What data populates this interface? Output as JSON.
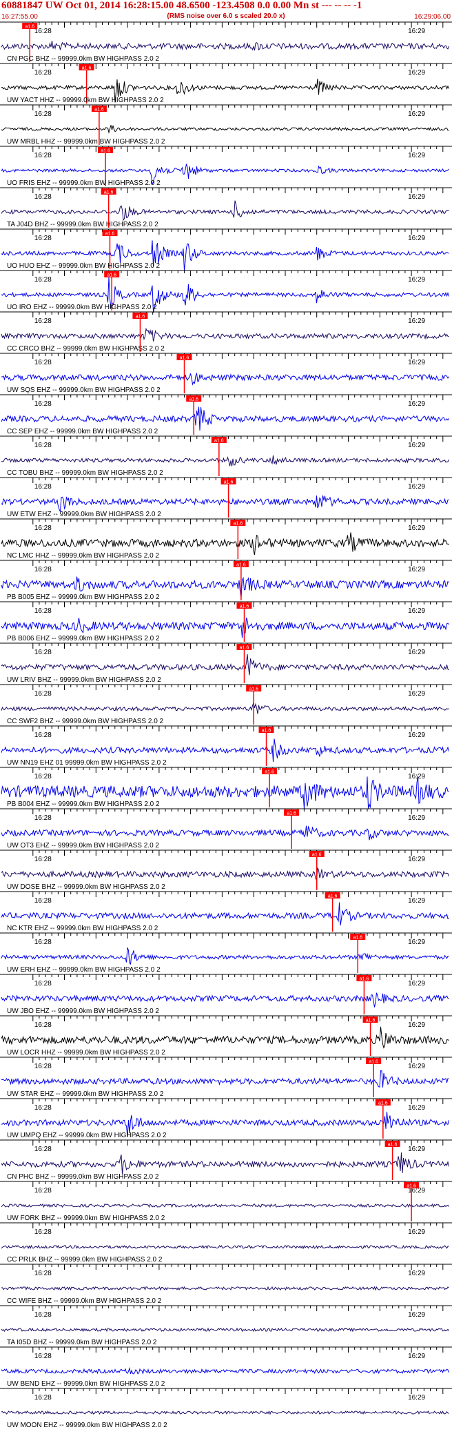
{
  "header": {
    "title": "60881847 UW Oct 01, 2014 16:28:15.00   48.6500 -123.4508  0.0 0.00 Mn st --- -- --   -1",
    "subtitle": "(RMS noise over 6.0 s scaled 20.0 x)",
    "start_time": "16:27:55.00",
    "end_time": "16:29:06.00"
  },
  "chart_data": {
    "type": "line",
    "title": "60881847 UW Oct 01, 2014 16:28:15.00   48.6500 -123.4508  0.0 0.00 Mn st --- -- --   -1",
    "subtitle": "(RMS noise over 6.0 s scaled 20.0 x)",
    "x_start": "16:27:55.00",
    "x_end": "16:29:06.00",
    "xlim_seconds": [
      0,
      71
    ],
    "tick_labels": [
      "16:28",
      "16:29"
    ],
    "pick_label": "a1.6",
    "grid": false,
    "colors": {
      "title": "#cc0000",
      "pick": "#ff0000",
      "black": "#000000",
      "blue": "#0000ee",
      "navy": "#1a0a66"
    },
    "series": [
      {
        "name": "CN PGC BHZ -- 99999.0km BW  HIGHPASS  2.0  2",
        "pick_s": 4.5,
        "color": "navy",
        "amp": 0.3,
        "bursts": [
          [
            8,
            0.4
          ],
          [
            40,
            0.3
          ]
        ]
      },
      {
        "name": "UW YACT HHZ -- 99999.0km BW  HIGHPASS  2.0  2",
        "pick_s": 13.5,
        "color": "black",
        "amp": 0.2,
        "bursts": [
          [
            18,
            1.8
          ],
          [
            28,
            1.2
          ],
          [
            50,
            0.9
          ]
        ]
      },
      {
        "name": "UW MRBL HHZ -- 99999.0km BW  HIGHPASS  2.0  2",
        "pick_s": 15.5,
        "color": "black",
        "amp": 0.15,
        "bursts": [
          [
            17,
            0.4
          ]
        ]
      },
      {
        "name": "UO FRIS EHZ -- 99999.0km BW  HIGHPASS  2.0  2",
        "pick_s": 16.5,
        "color": "blue",
        "amp": 0.15,
        "bursts": [
          [
            24,
            2.0
          ],
          [
            29,
            1.6
          ],
          [
            50,
            0.5
          ]
        ]
      },
      {
        "name": "TA J04D BHZ -- 99999.0km BW  HIGHPASS  2.0  2",
        "pick_s": 17.0,
        "color": "navy",
        "amp": 0.2,
        "bursts": [
          [
            19,
            1.2
          ],
          [
            37,
            1.0
          ]
        ]
      },
      {
        "name": "UO HUO EHZ -- 99999.0km BW  HIGHPASS  2.0  2",
        "pick_s": 17.2,
        "color": "blue",
        "amp": 0.2,
        "bursts": [
          [
            18,
            1.8
          ],
          [
            24,
            2.2
          ],
          [
            29,
            1.8
          ],
          [
            50,
            0.8
          ]
        ]
      },
      {
        "name": "UO IRO EHZ -- 99999.0km BW  HIGHPASS  2.0  2",
        "pick_s": 17.5,
        "color": "blue",
        "amp": 0.2,
        "bursts": [
          [
            17,
            1.8
          ],
          [
            24,
            2.2
          ],
          [
            29,
            1.8
          ],
          [
            50,
            0.8
          ]
        ]
      },
      {
        "name": "CC CRCO BHZ -- 99999.0km BW  HIGHPASS  2.0  2",
        "pick_s": 22.0,
        "color": "navy",
        "amp": 0.25,
        "bursts": [
          [
            23,
            1.0
          ]
        ]
      },
      {
        "name": "UW SQS EHZ -- 99999.0km BW  HIGHPASS  2.0  2",
        "pick_s": 29.0,
        "color": "blue",
        "amp": 0.3,
        "bursts": [
          [
            30,
            0.6
          ]
        ]
      },
      {
        "name": "CC SEP EHZ -- 99999.0km BW  HIGHPASS  2.0  2",
        "pick_s": 30.5,
        "color": "blue",
        "amp": 0.3,
        "bursts": [
          [
            31,
            1.8
          ]
        ]
      },
      {
        "name": "CC TOBU BHZ -- 99999.0km BW  HIGHPASS  2.0  2",
        "pick_s": 34.5,
        "color": "navy",
        "amp": 0.2,
        "bursts": [
          [
            36,
            0.8
          ],
          [
            43,
            0.6
          ]
        ]
      },
      {
        "name": "UW ETW EHZ -- 99999.0km BW  HIGHPASS  2.0  2",
        "pick_s": 36.0,
        "color": "blue",
        "amp": 0.3,
        "bursts": [
          [
            9,
            1.2
          ],
          [
            50,
            1.2
          ]
        ]
      },
      {
        "name": "NC LMC HHZ -- 99999.0km BW  HIGHPASS  2.0  2",
        "pick_s": 37.5,
        "color": "black",
        "amp": 0.4,
        "bursts": [
          [
            40,
            1.0
          ],
          [
            55,
            1.0
          ]
        ]
      },
      {
        "name": "PB B005 EHZ -- 99999.0km BW  HIGHPASS  2.0  2",
        "pick_s": 38.0,
        "color": "blue",
        "amp": 0.4,
        "bursts": [
          [
            12,
            0.7
          ],
          [
            38,
            1.3
          ]
        ]
      },
      {
        "name": "PB B006 EHZ -- 99999.0km BW  HIGHPASS  2.0  2",
        "pick_s": 38.5,
        "color": "blue",
        "amp": 0.4,
        "bursts": [
          [
            12,
            0.7
          ],
          [
            38,
            1.3
          ]
        ]
      },
      {
        "name": "UW LRIV BHZ -- 99999.0km BW  HIGHPASS  2.0  2",
        "pick_s": 38.5,
        "color": "navy",
        "amp": 0.3,
        "bursts": [
          [
            39,
            1.2
          ]
        ]
      },
      {
        "name": "CC SWF2 BHZ -- 99999.0km BW  HIGHPASS  2.0  2",
        "pick_s": 40.0,
        "color": "navy",
        "amp": 0.2,
        "bursts": [
          [
            40,
            0.8
          ]
        ]
      },
      {
        "name": "UW NN19 EHZ 01 99999.0km BW  HIGHPASS  2.0  2",
        "pick_s": 42.0,
        "color": "blue",
        "amp": 0.3,
        "bursts": [
          [
            43,
            1.1
          ],
          [
            50,
            0.6
          ]
        ]
      },
      {
        "name": "PB B004 EHZ -- 99999.0km BW  HIGHPASS  2.0  2",
        "pick_s": 42.5,
        "color": "blue",
        "amp": 0.6,
        "bursts": [
          [
            48,
            2.2
          ],
          [
            58,
            1.8
          ],
          [
            66,
            1.2
          ]
        ]
      },
      {
        "name": "UW OT3 EHZ -- 99999.0km BW  HIGHPASS  2.0  2",
        "pick_s": 46.0,
        "color": "blue",
        "amp": 0.3,
        "bursts": [
          [
            48,
            1.0
          ],
          [
            58,
            0.6
          ]
        ]
      },
      {
        "name": "UW DOSE BHZ -- 99999.0km BW  HIGHPASS  2.0  2",
        "pick_s": 50.0,
        "color": "navy",
        "amp": 0.3,
        "bursts": [
          [
            50,
            0.5
          ]
        ]
      },
      {
        "name": "NC KTR EHZ -- 99999.0km BW  HIGHPASS  2.0  2",
        "pick_s": 52.5,
        "color": "blue",
        "amp": 0.3,
        "bursts": [
          [
            53,
            1.9
          ]
        ]
      },
      {
        "name": "UW ERH EHZ -- 99999.0km BW  HIGHPASS  2.0  2",
        "pick_s": 56.5,
        "color": "blue",
        "amp": 0.2,
        "bursts": [
          [
            20,
            1.2
          ],
          [
            57,
            0.6
          ]
        ]
      },
      {
        "name": "UW JBO EHZ -- 99999.0km BW  HIGHPASS  2.0  2",
        "pick_s": 57.5,
        "color": "blue",
        "amp": 0.3,
        "bursts": [
          [
            59,
            0.8
          ]
        ]
      },
      {
        "name": "UW LOCR HHZ -- 99999.0km BW  HIGHPASS  2.0  2",
        "pick_s": 58.5,
        "color": "black",
        "amp": 0.4,
        "bursts": [
          [
            60,
            1.2
          ]
        ]
      },
      {
        "name": "UW STAR EHZ -- 99999.0km BW  HIGHPASS  2.0  2",
        "pick_s": 59.0,
        "color": "blue",
        "amp": 0.3,
        "bursts": [
          [
            60,
            1.1
          ]
        ]
      },
      {
        "name": "UW UMPQ EHZ -- 99999.0km BW  HIGHPASS  2.0  2",
        "pick_s": 60.5,
        "color": "blue",
        "amp": 0.3,
        "bursts": [
          [
            20,
            1.6
          ],
          [
            61,
            1.6
          ]
        ]
      },
      {
        "name": "CN PHC BHZ -- 99999.0km BW  HIGHPASS  2.0  2",
        "pick_s": 62.0,
        "color": "navy",
        "amp": 0.3,
        "bursts": [
          [
            19,
            1.0
          ],
          [
            63,
            1.4
          ]
        ]
      },
      {
        "name": "UW FORK BHZ -- 99999.0km BW  HIGHPASS  2.0  2",
        "pick_s": 65.0,
        "color": "navy",
        "amp": 0.15,
        "bursts": []
      },
      {
        "name": "CC PRLK BHZ -- 99999.0km BW  HIGHPASS  2.0  2",
        "pick_s": null,
        "color": "navy",
        "amp": 0.15,
        "bursts": []
      },
      {
        "name": "CC WIFE BHZ -- 99999.0km BW  HIGHPASS  2.0  2",
        "pick_s": null,
        "color": "navy",
        "amp": 0.15,
        "bursts": []
      },
      {
        "name": "TA I05D BHZ -- 99999.0km BW  HIGHPASS  2.0  2",
        "pick_s": null,
        "color": "navy",
        "amp": 0.15,
        "bursts": []
      },
      {
        "name": "UW BEND EHZ -- 99999.0km BW  HIGHPASS  2.0  2",
        "pick_s": null,
        "color": "blue",
        "amp": 0.2,
        "bursts": [
          [
            20,
            0.4
          ]
        ]
      },
      {
        "name": "UW MOON EHZ -- 99999.0km BW  HIGHPASS  2.0  2",
        "pick_s": null,
        "color": "navy",
        "amp": 0.15,
        "bursts": []
      }
    ]
  }
}
